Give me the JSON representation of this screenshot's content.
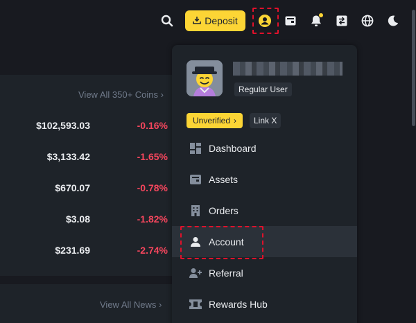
{
  "header": {
    "deposit_label": "Deposit",
    "icons": [
      "search-icon",
      "deposit-download-icon",
      "user-icon",
      "wallet-icon",
      "bell-icon",
      "transfer-icon",
      "globe-icon",
      "moon-icon"
    ]
  },
  "markets": {
    "view_all_coins": "View All 350+ Coins",
    "rows": [
      {
        "price": "$102,593.03",
        "change": "-0.16%"
      },
      {
        "price": "$3,133.42",
        "change": "-1.65%"
      },
      {
        "price": "$670.07",
        "change": "-0.78%"
      },
      {
        "price": "$3.08",
        "change": "-1.82%"
      },
      {
        "price": "$231.69",
        "change": "-2.74%"
      }
    ],
    "view_all_news": "View All News"
  },
  "profile": {
    "role": "Regular User",
    "verification": "Unverified",
    "link": "Link X"
  },
  "menu": {
    "items": [
      {
        "label": "Dashboard",
        "icon": "dashboard-icon"
      },
      {
        "label": "Assets",
        "icon": "wallet-icon"
      },
      {
        "label": "Orders",
        "icon": "orders-icon"
      },
      {
        "label": "Account",
        "icon": "person-icon",
        "active": true
      },
      {
        "label": "Referral",
        "icon": "add-user-icon"
      },
      {
        "label": "Rewards Hub",
        "icon": "ticket-icon"
      }
    ]
  },
  "colors": {
    "accent": "#fcd535",
    "negative": "#f6465d",
    "background": "#181a20",
    "panel": "#1e2329",
    "highlight": "#e0112b"
  }
}
